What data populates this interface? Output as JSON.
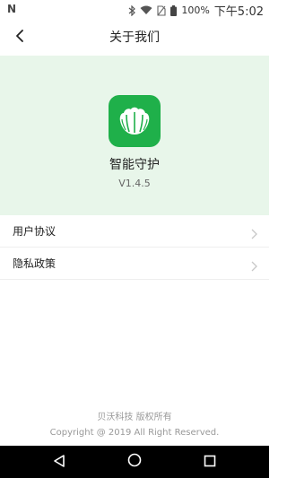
{
  "status_bar": {
    "left_icon": "N",
    "battery_text": "100%",
    "time": "下午5:02"
  },
  "header": {
    "title": "关于我们"
  },
  "app": {
    "name": "智能守护",
    "version": "V1.4.5"
  },
  "menu": {
    "items": [
      {
        "label": "用户协议"
      },
      {
        "label": "隐私政策"
      }
    ]
  },
  "footer": {
    "company": "贝沃科技 版权所有",
    "copyright": "Copyright @ 2019 All Right Reserved."
  },
  "colors": {
    "accent": "#1fb04a",
    "hero_bg": "#e8f6ea"
  }
}
